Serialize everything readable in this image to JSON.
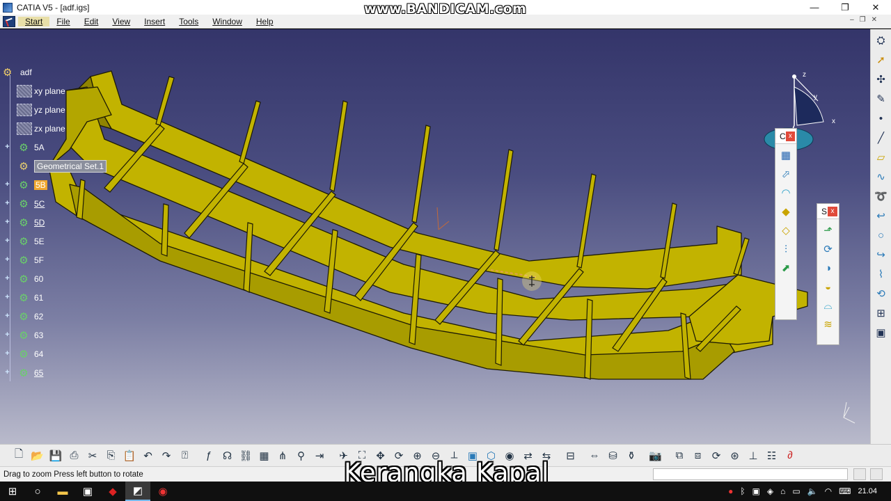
{
  "window": {
    "title": "CATIA V5 - [adf.igs]",
    "watermark": "www.BANDICAM.com",
    "minimize": "—",
    "maximize": "❐",
    "close": "✕"
  },
  "menu": {
    "items": [
      "Start",
      "File",
      "Edit",
      "View",
      "Insert",
      "Tools",
      "Window",
      "Help"
    ],
    "mdi_minimize": "–",
    "mdi_restore": "❐",
    "mdi_close": "✕"
  },
  "tree": {
    "root": "adf",
    "nodes": [
      {
        "label": "xy plane",
        "type": "plane"
      },
      {
        "label": "yz plane",
        "type": "plane"
      },
      {
        "label": "zx plane",
        "type": "plane"
      },
      {
        "label": "5A",
        "type": "body"
      },
      {
        "label": "Geometrical Set.1",
        "type": "geoset"
      },
      {
        "label": "5B",
        "type": "body"
      },
      {
        "label": "5C",
        "type": "body"
      },
      {
        "label": "5D",
        "type": "body"
      },
      {
        "label": "5E",
        "type": "body"
      },
      {
        "label": "5F",
        "type": "body"
      },
      {
        "label": "60",
        "type": "body"
      },
      {
        "label": "61",
        "type": "body"
      },
      {
        "label": "62",
        "type": "body"
      },
      {
        "label": "63",
        "type": "body"
      },
      {
        "label": "64",
        "type": "body"
      },
      {
        "label": "65",
        "type": "body"
      }
    ]
  },
  "compass": {
    "x": "x",
    "y": "y",
    "z": "z"
  },
  "float_toolbars": {
    "curves": {
      "title": "C",
      "close": "x"
    },
    "surfaces": {
      "title": "S",
      "close": "x"
    }
  },
  "status": {
    "message": "Drag to zoom  Press left button to rotate"
  },
  "subtitle": "Kerangka Kapal",
  "taskbar": {
    "clock": "21.04"
  },
  "colors": {
    "hull": "#c2b300",
    "hull_dark": "#8f8400",
    "viewport_top": "#34356a",
    "viewport_bottom": "#b9bacb"
  }
}
